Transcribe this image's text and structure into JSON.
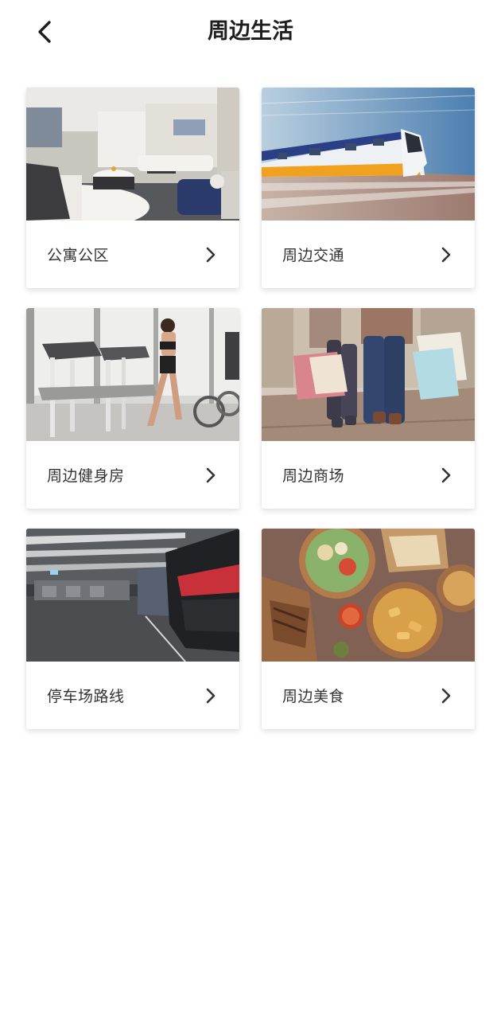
{
  "header": {
    "title": "周边生活",
    "back_icon": "chevron-left-icon"
  },
  "cards": [
    {
      "label": "公寓公区",
      "photo": "apartment-lounge-photo",
      "icon": "chevron-right-icon"
    },
    {
      "label": "周边交通",
      "photo": "train-photo",
      "icon": "chevron-right-icon"
    },
    {
      "label": "周边健身房",
      "photo": "gym-photo",
      "icon": "chevron-right-icon"
    },
    {
      "label": "周边商场",
      "photo": "shopping-photo",
      "icon": "chevron-right-icon"
    },
    {
      "label": "停车场路线",
      "photo": "parking-garage-photo",
      "icon": "chevron-right-icon"
    },
    {
      "label": "周边美食",
      "photo": "food-photo",
      "icon": "chevron-right-icon"
    }
  ],
  "colors": {
    "background": "#ffffff",
    "title_text": "#1e1e1e",
    "label_text": "#333333",
    "icon": "#333333"
  }
}
